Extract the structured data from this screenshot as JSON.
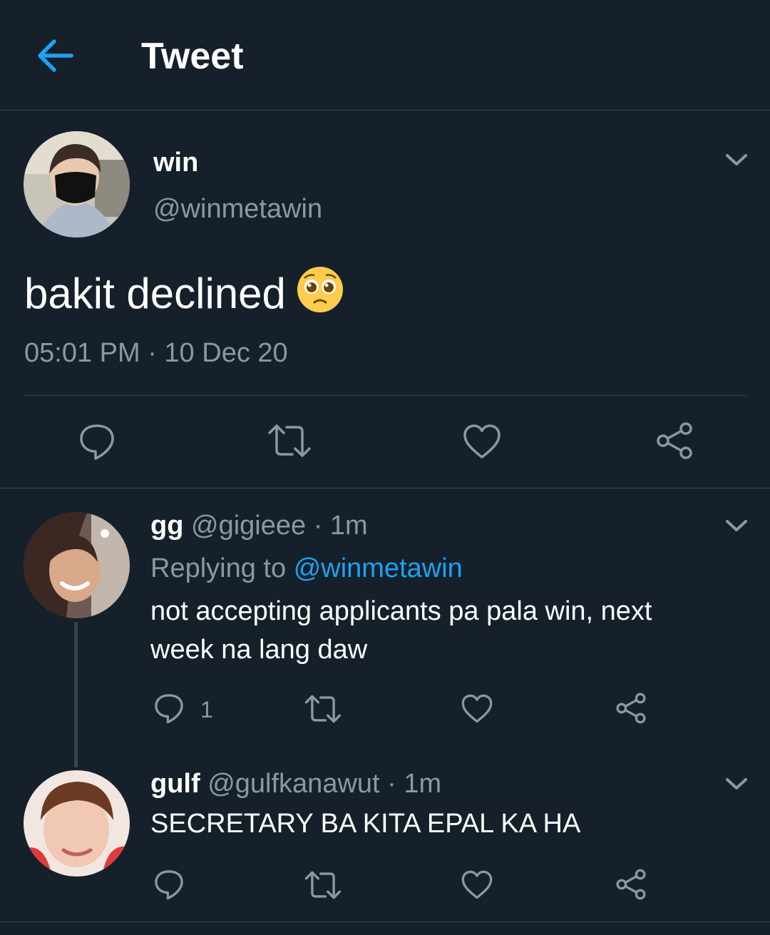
{
  "header": {
    "title": "Tweet"
  },
  "tweet": {
    "name": "win",
    "handle": "@winmetawin",
    "text": "bakit declined",
    "emoji": "pleading-face",
    "timestamp": "05:01 PM · 10 Dec 20"
  },
  "replies": [
    {
      "name": "gg",
      "handle": "@gigieee",
      "time": "· 1m",
      "replying_label": "Replying to",
      "replying_handle": "@winmetawin",
      "text_line1": "not accepting applicants pa pala win, next",
      "text_line2": "week na lang daw",
      "reply_count": "1"
    },
    {
      "name": "gulf",
      "handle": "@gulfkanawut",
      "time": "· 1m",
      "text": "SECRETARY BA KITA EPAL KA HA"
    }
  ],
  "colors": {
    "background": "#15202b",
    "accent": "#1da1f2",
    "secondary_text": "#8899a6",
    "divider": "#38444d"
  },
  "icons": [
    "back-arrow-icon",
    "chevron-down-icon",
    "reply-icon",
    "retweet-icon",
    "like-icon",
    "share-icon"
  ]
}
